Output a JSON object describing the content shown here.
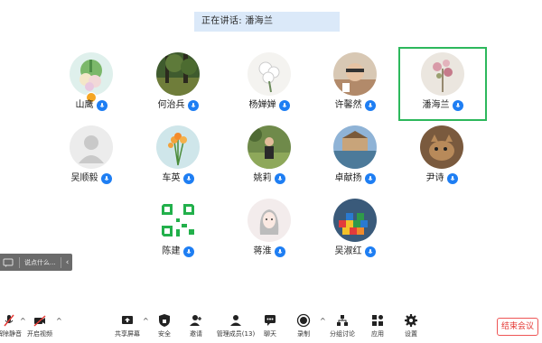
{
  "banner": {
    "speaking_text": "正在讲话: 潘海兰"
  },
  "participants": [
    {
      "name": "山鹰",
      "avatar": "flower-bouquet",
      "host": true,
      "active": false
    },
    {
      "name": "何治兵",
      "avatar": "forest-path",
      "host": false,
      "active": false
    },
    {
      "name": "杨婵婵",
      "avatar": "white-flowers",
      "host": false,
      "active": false
    },
    {
      "name": "许馨然",
      "avatar": "child-photo",
      "host": false,
      "active": false
    },
    {
      "name": "潘海兰",
      "avatar": "dried-flowers",
      "host": false,
      "active": true
    },
    {
      "name": "吴顺毅",
      "avatar": "default-person",
      "host": false,
      "active": false
    },
    {
      "name": "车英",
      "avatar": "tulips-vase",
      "host": false,
      "active": false
    },
    {
      "name": "姚莉",
      "avatar": "person-in-park",
      "host": false,
      "active": false
    },
    {
      "name": "卓献扬",
      "avatar": "palace-lake",
      "host": false,
      "active": false
    },
    {
      "name": "尹诗",
      "avatar": "cat-photo",
      "host": false,
      "active": false
    },
    {
      "name": "陈建",
      "avatar": "qr-code",
      "host": false,
      "active": false
    },
    {
      "name": "蒋淮",
      "avatar": "girl-sketch",
      "host": false,
      "active": false
    },
    {
      "name": "吴淑红",
      "avatar": "toy-blocks",
      "host": false,
      "active": false
    }
  ],
  "chat_pill": {
    "text": "说点什么..."
  },
  "toolbar": {
    "mute_label": "解除静音",
    "video_label": "开启视频",
    "share_label": "共享屏幕",
    "security_label": "安全",
    "invite_label": "邀请",
    "participants_label": "管理成员(13)",
    "chat_label": "聊天",
    "record_label": "录制",
    "breakout_label": "分组讨论",
    "apps_label": "应用",
    "settings_label": "设置",
    "leave_label": "结束会议"
  },
  "colors": {
    "mic_badge": "#1e7ef3",
    "active_border": "#2db85c",
    "leave_red": "#e53935",
    "banner_bg": "#dbe9f9"
  }
}
